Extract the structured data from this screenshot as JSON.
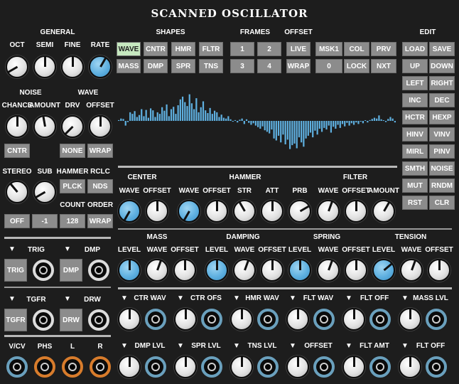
{
  "title": "SCANNED OSCILLATOR",
  "general": {
    "header": "GENERAL",
    "labels": [
      "OCT",
      "SEMI",
      "FINE",
      "RATE"
    ]
  },
  "noise": {
    "header": "NOISE",
    "labels": [
      "CHANCE",
      "AMOUNT"
    ],
    "cntr": "CNTR"
  },
  "wave_section": {
    "header": "WAVE",
    "labels": [
      "DRV",
      "OFFSET"
    ],
    "none": "NONE",
    "wrap": "WRAP"
  },
  "stereo": {
    "stereo_label": "STEREO",
    "sub_label": "SUB",
    "hammer_label": "HAMMER",
    "rclc_label": "RCLC",
    "plck": "PLCK",
    "nds": "NDS",
    "count_label": "COUNT",
    "order_label": "ORDER",
    "off": "OFF",
    "minus1": "-1",
    "v128": "128",
    "wrap": "WRAP"
  },
  "shapes": {
    "header": "SHAPES",
    "buttons": [
      "WAVE",
      "CNTR",
      "HMR",
      "FLTR",
      "MASS",
      "DMP",
      "SPR",
      "TNS"
    ]
  },
  "frames": {
    "header": "FRAMES",
    "buttons": [
      "1",
      "2",
      "3",
      "4"
    ]
  },
  "offset": {
    "header": "OFFSET",
    "buttons": [
      "LIVE",
      "WRAP"
    ]
  },
  "misc": {
    "buttons": [
      "MSK1",
      "COL",
      "PRV",
      "0",
      "LOCK",
      "NXT"
    ]
  },
  "edit": {
    "header": "EDIT",
    "buttons": [
      "LOAD",
      "SAVE",
      "UP",
      "DOWN",
      "LEFT",
      "RIGHT",
      "INC",
      "DEC",
      "HCTR",
      "HEXP",
      "HINV",
      "VINV",
      "MIRL",
      "PINV",
      "SMTH",
      "NOISE",
      "MUT",
      "RNDM",
      "RST",
      "CLR"
    ]
  },
  "waveform": {
    "values": [
      0.02,
      0.06,
      0.05,
      -0.12,
      -0.03,
      0.22,
      0.18,
      0.25,
      0.1,
      0.15,
      0.3,
      0.12,
      0.28,
      0.08,
      0.32,
      0.27,
      0.1,
      0.22,
      0.18,
      0.35,
      0.26,
      0.42,
      0.12,
      0.3,
      0.36,
      0.18,
      0.4,
      0.55,
      0.62,
      0.48,
      0.38,
      0.68,
      0.45,
      0.3,
      0.58,
      0.22,
      0.35,
      0.5,
      0.27,
      0.2,
      0.33,
      0.18,
      0.26,
      0.22,
      0.1,
      0.16,
      0.08,
      0.06,
      0.12,
      0.04,
      -0.02,
      0.02,
      -0.04,
      0.03,
      0.06,
      -0.08,
      0.04,
      -0.05,
      -0.1,
      -0.06,
      -0.12,
      -0.16,
      -0.2,
      -0.14,
      -0.24,
      -0.28,
      -0.32,
      -0.22,
      -0.45,
      -0.5,
      -0.38,
      -0.55,
      -0.35,
      -0.6,
      -0.48,
      -0.72,
      -0.62,
      -0.58,
      -0.7,
      -0.42,
      -0.55,
      -0.66,
      -0.45,
      -0.38,
      -0.3,
      -0.42,
      -0.25,
      -0.35,
      -0.2,
      -0.28,
      -0.18,
      -0.22,
      -0.12,
      -0.3,
      -0.15,
      -0.2,
      -0.1,
      -0.18,
      -0.08,
      -0.14,
      -0.05,
      -0.12,
      -0.06,
      -0.1,
      -0.04,
      -0.08,
      -0.02,
      -0.06,
      0.0,
      -0.04,
      0.02,
      0.05,
      0.08,
      0.06,
      0.14,
      0.04,
      0.0,
      -0.03,
      0.05,
      0.1,
      0.06,
      -0.04
    ],
    "color": "#5fb0e0"
  },
  "center": {
    "header": "CENTER",
    "labels": [
      "WAVE",
      "OFFSET"
    ]
  },
  "hammer": {
    "header": "HAMMER",
    "labels": [
      "WAVE",
      "OFFSET",
      "STR",
      "ATT",
      "PRB"
    ]
  },
  "filter": {
    "header": "FILTER",
    "labels": [
      "WAVE",
      "OFFSET",
      "AMOUNT"
    ]
  },
  "mass": {
    "header": "MASS",
    "labels": [
      "LEVEL",
      "WAVE",
      "OFFSET"
    ]
  },
  "damping": {
    "header": "DAMPING",
    "labels": [
      "LEVEL",
      "WAVE",
      "OFFSET"
    ]
  },
  "spring": {
    "header": "SPRING",
    "labels": [
      "LEVEL",
      "WAVE",
      "OFFSET"
    ]
  },
  "tension": {
    "header": "TENSION",
    "labels": [
      "LEVEL",
      "WAVE",
      "OFFSET"
    ]
  },
  "trig": {
    "trig_label": "TRIG",
    "dmp_label": "DMP",
    "trig_btn": "TRIG",
    "dmp_btn": "DMP",
    "tgfr_label": "TGFR",
    "drw_label": "DRW",
    "tgfr_btn": "TGFR",
    "drw_btn": "DRW"
  },
  "outputs": {
    "labels": [
      "V/CV",
      "PHS",
      "L",
      "R"
    ]
  },
  "cv_row1": [
    "CTR WAV",
    "CTR OFS",
    "HMR WAV",
    "FLT WAV",
    "FLT OFF",
    "MASS LVL"
  ],
  "cv_row2": [
    "DMP LVL",
    "SPR LVL",
    "TNS LVL",
    "OFFSET",
    "FLT AMT",
    "FLT OFF"
  ],
  "colors": {
    "panel": "#1d1d1d",
    "accent_blue": "#5fb0e0",
    "active_green": "#c6e8bf",
    "button_gray": "#8c8c8c",
    "jack_blue": "#6aa0bd",
    "jack_orange": "#d87c2c"
  }
}
